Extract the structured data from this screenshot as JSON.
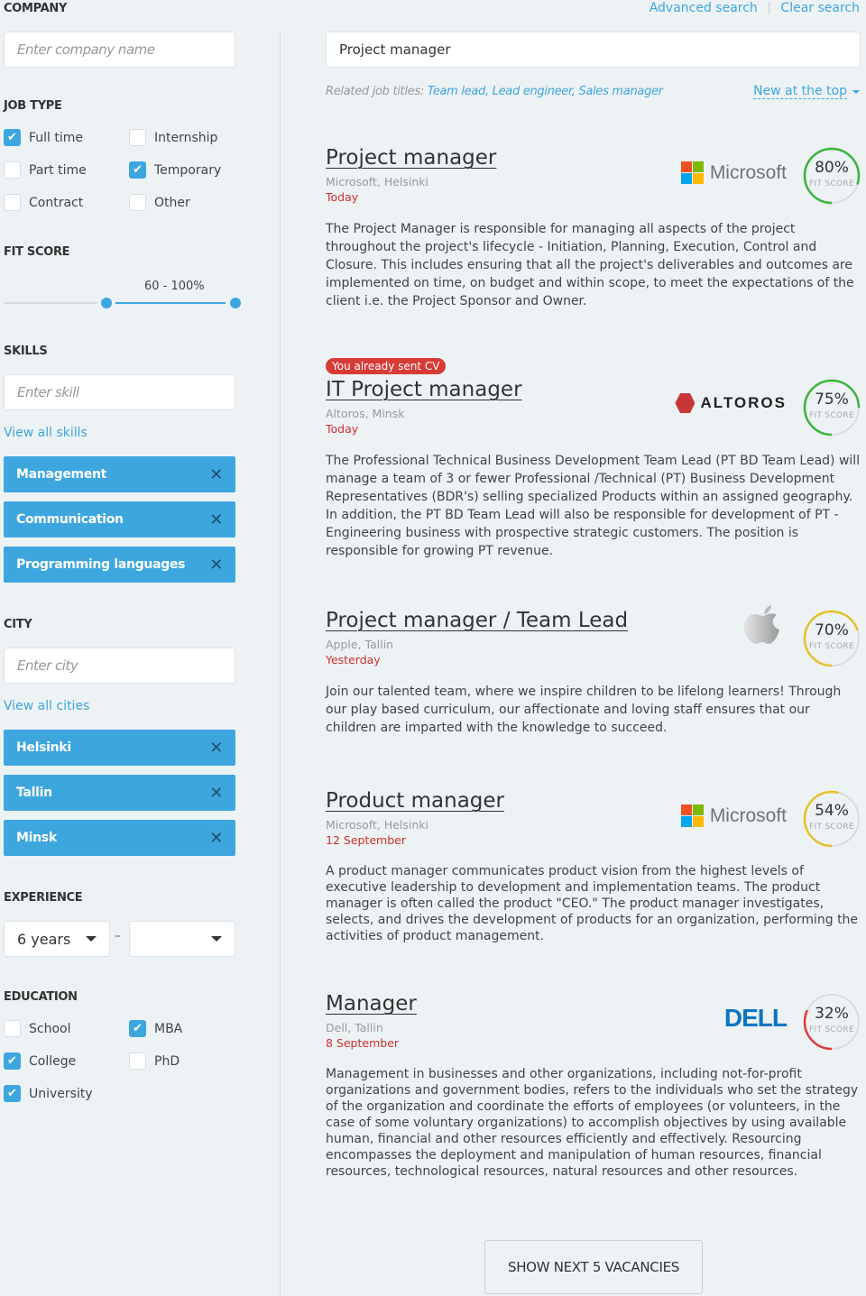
{
  "header": {
    "advanced_search": "Advanced search",
    "clear_search": "Clear search",
    "separator": "|"
  },
  "search": {
    "value": "Project manager"
  },
  "related": {
    "label": "Related job titles:",
    "titles": "Team lead, Lead engineer, Sales manager"
  },
  "sort": {
    "label": "New at the top"
  },
  "sidebar": {
    "company": {
      "heading": "COMPANY",
      "placeholder": "Enter company name"
    },
    "job_type": {
      "heading": "JOB TYPE",
      "options": [
        {
          "label": "Full time",
          "checked": true
        },
        {
          "label": "Internship",
          "checked": false
        },
        {
          "label": "Part time",
          "checked": false
        },
        {
          "label": "Temporary",
          "checked": true
        },
        {
          "label": "Contract",
          "checked": false
        },
        {
          "label": "Other",
          "checked": false
        }
      ]
    },
    "fit_score": {
      "heading": "FIT SCORE",
      "range_label": "60 - 100%",
      "min": 60,
      "max": 100
    },
    "skills": {
      "heading": "SKILLS",
      "placeholder": "Enter skill",
      "view_all": "View all skills",
      "tags": [
        "Management",
        "Communication",
        "Programming languages"
      ]
    },
    "city": {
      "heading": "CITY",
      "placeholder": "Enter city",
      "view_all": "View all cities",
      "tags": [
        "Helsinki",
        "Tallin",
        "Minsk"
      ]
    },
    "experience": {
      "heading": "EXPERIENCE",
      "from": "6 years",
      "dash": "–",
      "to": ""
    },
    "education": {
      "heading": "EDUCATION",
      "options": [
        {
          "label": "School",
          "checked": false
        },
        {
          "label": "MBA",
          "checked": true
        },
        {
          "label": "College",
          "checked": true
        },
        {
          "label": "PhD",
          "checked": false
        },
        {
          "label": "University",
          "checked": true
        }
      ]
    }
  },
  "jobs": [
    {
      "title": "Project manager",
      "company": "Microsoft, Helsinki",
      "date": "Today",
      "logo": "Microsoft",
      "score": 80,
      "score_label": "FIT SCORE",
      "color": "#3db33d",
      "badge": "",
      "desc": "The Project Manager is responsible for managing all aspects of the project throughout the project's lifecycle - Initiation, Planning, Execution, Control and Closure. This includes ensuring that all the project's deliverables and outcomes are implemented on time, on budget and within scope, to meet the expectations of the client i.e. the Project Sponsor and Owner."
    },
    {
      "title": "IT Project manager",
      "company": "Altoros, Minsk",
      "date": "Today",
      "logo": "ALTOROS",
      "score": 75,
      "score_label": "FIT SCORE",
      "color": "#3db33d",
      "badge": "You already sent CV",
      "desc": "The Professional Technical Business Development Team Lead (PT BD Team Lead) will manage a team of 3 or fewer Professional /Technical (PT) Business Development Representatives (BDR's) selling specialized Products within an assigned geography. In addition, the PT BD Team Lead will also be responsible for development of PT - Engineering business with prospective strategic customers. The position is responsible for growing PT revenue."
    },
    {
      "title": "Project manager / Team Lead",
      "company": "Apple, Tallin",
      "date": "Yesterday",
      "logo": "Apple",
      "score": 70,
      "score_label": "FIT SCORE",
      "color": "#e5c12a",
      "badge": "",
      "desc": "Join our talented team, where we inspire children to be lifelong learners! Through our play based curriculum, our affectionate and loving staff ensures that our children are imparted with the knowledge to succeed."
    },
    {
      "title": "Product manager",
      "company": "Microsoft, Helsinki",
      "date": "12 September",
      "logo": "Microsoft",
      "score": 54,
      "score_label": "FIT SCORE",
      "color": "#e5c12a",
      "badge": "",
      "desc": "A product manager communicates product vision from the highest levels of executive leadership to development and implementation teams. The product manager is often called the product \"CEO.\" The product manager investigates, selects, and drives the development of products for an organization, performing the activities of product management."
    },
    {
      "title": "Manager",
      "company": "Dell, Tallin",
      "date": "8 September",
      "logo": "DELL",
      "score": 32,
      "score_label": "FIT SCORE",
      "color": "#e03a3a",
      "badge": "",
      "desc": "Management in businesses and other organizations, including not-for-profit organizations and government bodies, refers to the individuals who set the strategy of the organization and coordinate the efforts of employees (or volunteers, in the case of some voluntary organizations) to accomplish objectives by using available human, financial and other resources efficiently and effectively. Resourcing encompasses the deployment and manipulation of human resources, financial resources, technological resources, natural resources and other resources."
    }
  ],
  "show_more": "SHOW NEXT 5 VACANCIES",
  "colors": {
    "accent": "#3ea6df",
    "background": "#edf2f5",
    "date": "#d0312d"
  }
}
